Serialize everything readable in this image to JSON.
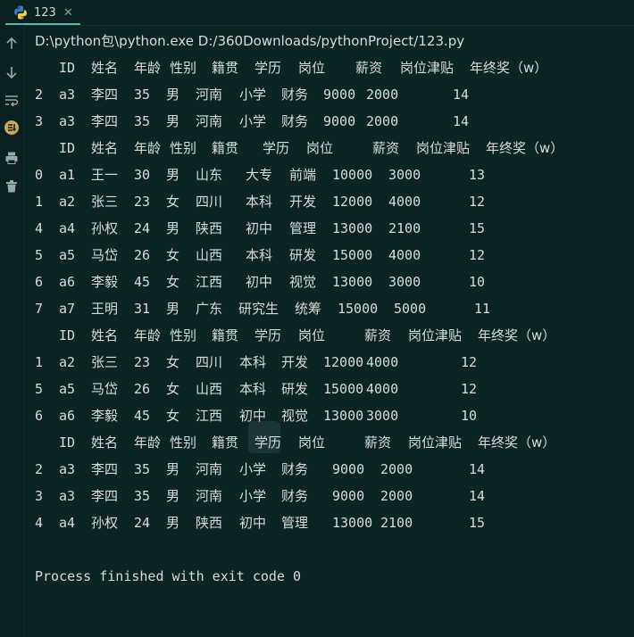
{
  "tab": {
    "title": "123",
    "icon": "python-icon",
    "close": "✕"
  },
  "gutter": {
    "buttons": [
      "up-arrow-icon",
      "down-arrow-icon",
      "soft-wrap-icon",
      "scroll-to-end-icon",
      "print-icon",
      "trash-icon"
    ]
  },
  "console": {
    "command": "D:\\python包\\python.exe D:/360Downloads/pythonProject/123.py",
    "headers": [
      "ID",
      "姓名",
      "年龄",
      "性别",
      "籍贯",
      "学历",
      "岗位",
      "薪资",
      "岗位津贴",
      "年终奖（w）"
    ],
    "tables": [
      [
        [
          "2",
          "a3",
          "李四",
          "35",
          "男",
          "河南",
          "小学",
          "财务",
          "9000",
          "2000",
          "14"
        ],
        [
          "3",
          "a3",
          "李四",
          "35",
          "男",
          "河南",
          "小学",
          "财务",
          "9000",
          "2000",
          "14"
        ]
      ],
      [
        [
          "0",
          "a1",
          "王一",
          "30",
          "男",
          "山东",
          "大专",
          "前端",
          "10000",
          "3000",
          "13"
        ],
        [
          "1",
          "a2",
          "张三",
          "23",
          "女",
          "四川",
          "本科",
          "开发",
          "12000",
          "4000",
          "12"
        ],
        [
          "4",
          "a4",
          "孙权",
          "24",
          "男",
          "陕西",
          "初中",
          "管理",
          "13000",
          "2100",
          "15"
        ],
        [
          "5",
          "a5",
          "马岱",
          "26",
          "女",
          "山西",
          "本科",
          "研发",
          "15000",
          "4000",
          "12"
        ],
        [
          "6",
          "a6",
          "李毅",
          "45",
          "女",
          "江西",
          "初中",
          "视觉",
          "13000",
          "3000",
          "10"
        ],
        [
          "7",
          "a7",
          "王明",
          "31",
          "男",
          "广东",
          "研究生",
          "统筹",
          "15000",
          "5000",
          "11"
        ]
      ],
      [
        [
          "1",
          "a2",
          "张三",
          "23",
          "女",
          "四川",
          "本科",
          "开发",
          "12000",
          "4000",
          "12"
        ],
        [
          "5",
          "a5",
          "马岱",
          "26",
          "女",
          "山西",
          "本科",
          "研发",
          "15000",
          "4000",
          "12"
        ],
        [
          "6",
          "a6",
          "李毅",
          "45",
          "女",
          "江西",
          "初中",
          "视觉",
          "13000",
          "3000",
          "10"
        ]
      ],
      [
        [
          "2",
          "a3",
          "李四",
          "35",
          "男",
          "河南",
          "小学",
          "财务",
          "9000",
          "2000",
          "14"
        ],
        [
          "3",
          "a3",
          "李四",
          "35",
          "男",
          "河南",
          "小学",
          "财务",
          "9000",
          "2000",
          "14"
        ],
        [
          "4",
          "a4",
          "孙权",
          "24",
          "男",
          "陕西",
          "初中",
          "管理",
          "13000",
          "2100",
          "15"
        ]
      ]
    ],
    "exit_message": "Process finished with exit code 0"
  }
}
